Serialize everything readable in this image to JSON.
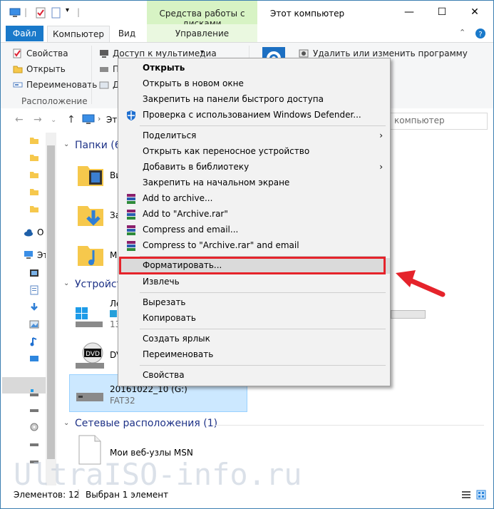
{
  "title_bar": {
    "context_tab": "Средства работы с дисками",
    "window_title": "Этот компьютер",
    "minimize": "—",
    "maximize": "☐",
    "close": "✕"
  },
  "ribbon_tabs": {
    "file": "Файл",
    "computer": "Компьютер",
    "view": "Вид",
    "manage": "Управление"
  },
  "ribbon": {
    "properties": "Свойства",
    "open": "Открыть",
    "rename": "Переименовать",
    "location_group": "Расположение",
    "media_access": "Доступ к мультимедиа",
    "uninstall": "Удалить или изменить программу",
    "p_cut": "П",
    "d_cut": "Д"
  },
  "address": {
    "back": "←",
    "forward": "→",
    "up": "↑",
    "crumb": "Эт",
    "search_placeholder": "компьютер"
  },
  "nav_pane": {
    "onedrive": "О",
    "this_pc": "Эт"
  },
  "content": {
    "folders_group": "Папки (6",
    "folder_video": "Ви",
    "folder_downloads": "За",
    "folder_music": "М",
    "devices_group": "Устройст",
    "local_disk": "Ло",
    "local_disk_size": "13",
    "dvd_label": "DVD",
    "dvd_name": "DV",
    "usb_name": "20161022_10 (G:)",
    "usb_fs": "FAT32",
    "network_group": "Сетевые расположения (1)",
    "msn": "Мои веб-узлы MSN"
  },
  "context_menu": {
    "open": "Открыть",
    "open_new_window": "Открыть в новом окне",
    "pin_quick": "Закрепить на панели быстрого доступа",
    "defender": "Проверка с использованием Windows Defender...",
    "share": "Поделиться",
    "open_portable": "Открыть как переносное устройство",
    "add_library": "Добавить в библиотеку",
    "pin_start": "Закрепить на начальном экране",
    "add_archive": "Add to archive...",
    "add_archive_rar": "Add to \"Archive.rar\"",
    "compress_email": "Compress and email...",
    "compress_rar_email": "Compress to \"Archive.rar\" and email",
    "format": "Форматировать...",
    "eject": "Извлечь",
    "cut": "Вырезать",
    "copy": "Копировать",
    "create_shortcut": "Создать ярлык",
    "rename": "Переименовать",
    "properties": "Свойства"
  },
  "status_bar": {
    "items": "Элементов: 12",
    "selected": "Выбран 1 элемент"
  },
  "watermark": "UltraISO-info.ru",
  "colors": {
    "accent": "#1979ca",
    "context_tab": "#d7f3c4",
    "highlight_box": "#e5232b",
    "selection": "#cce8ff"
  }
}
